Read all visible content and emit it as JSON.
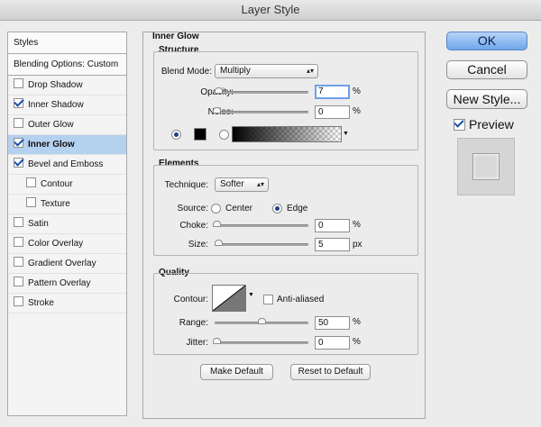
{
  "window": {
    "title": "Layer Style"
  },
  "left_panel": {
    "styles_label": "Styles",
    "blending_label": "Blending Options: Custom",
    "items": [
      {
        "label": "Drop Shadow",
        "checked": false
      },
      {
        "label": "Inner Shadow",
        "checked": true
      },
      {
        "label": "Outer Glow",
        "checked": false
      },
      {
        "label": "Inner Glow",
        "checked": true,
        "selected": true
      },
      {
        "label": "Bevel and Emboss",
        "checked": true
      },
      {
        "label": "Contour",
        "checked": false,
        "indent": true
      },
      {
        "label": "Texture",
        "checked": false,
        "indent": true
      },
      {
        "label": "Satin",
        "checked": false
      },
      {
        "label": "Color Overlay",
        "checked": false
      },
      {
        "label": "Gradient Overlay",
        "checked": false
      },
      {
        "label": "Pattern Overlay",
        "checked": false
      },
      {
        "label": "Stroke",
        "checked": false
      }
    ]
  },
  "inner_glow": {
    "title": "Inner Glow",
    "structure": {
      "title": "Structure",
      "blend_mode_label": "Blend Mode:",
      "blend_mode_value": "Multiply",
      "opacity_label": "Opacity:",
      "opacity_value": "7",
      "noise_label": "Noise:",
      "noise_value": "0",
      "unit": "%"
    },
    "elements": {
      "title": "Elements",
      "technique_label": "Technique:",
      "technique_value": "Softer",
      "source_label": "Source:",
      "source_center": "Center",
      "source_edge": "Edge",
      "choke_label": "Choke:",
      "choke_value": "0",
      "size_label": "Size:",
      "size_value": "5",
      "percent": "%",
      "px": "px"
    },
    "quality": {
      "title": "Quality",
      "contour_label": "Contour:",
      "anti_aliased_label": "Anti-aliased",
      "range_label": "Range:",
      "range_value": "50",
      "jitter_label": "Jitter:",
      "jitter_value": "0",
      "unit": "%"
    },
    "make_default": "Make Default",
    "reset_default": "Reset to Default"
  },
  "right_panel": {
    "ok": "OK",
    "cancel": "Cancel",
    "new_style": "New Style...",
    "preview_label": "Preview",
    "preview_checked": true
  },
  "colors": {
    "selected_row": "#b5d1f0",
    "default_button": "#6fa6ea"
  }
}
